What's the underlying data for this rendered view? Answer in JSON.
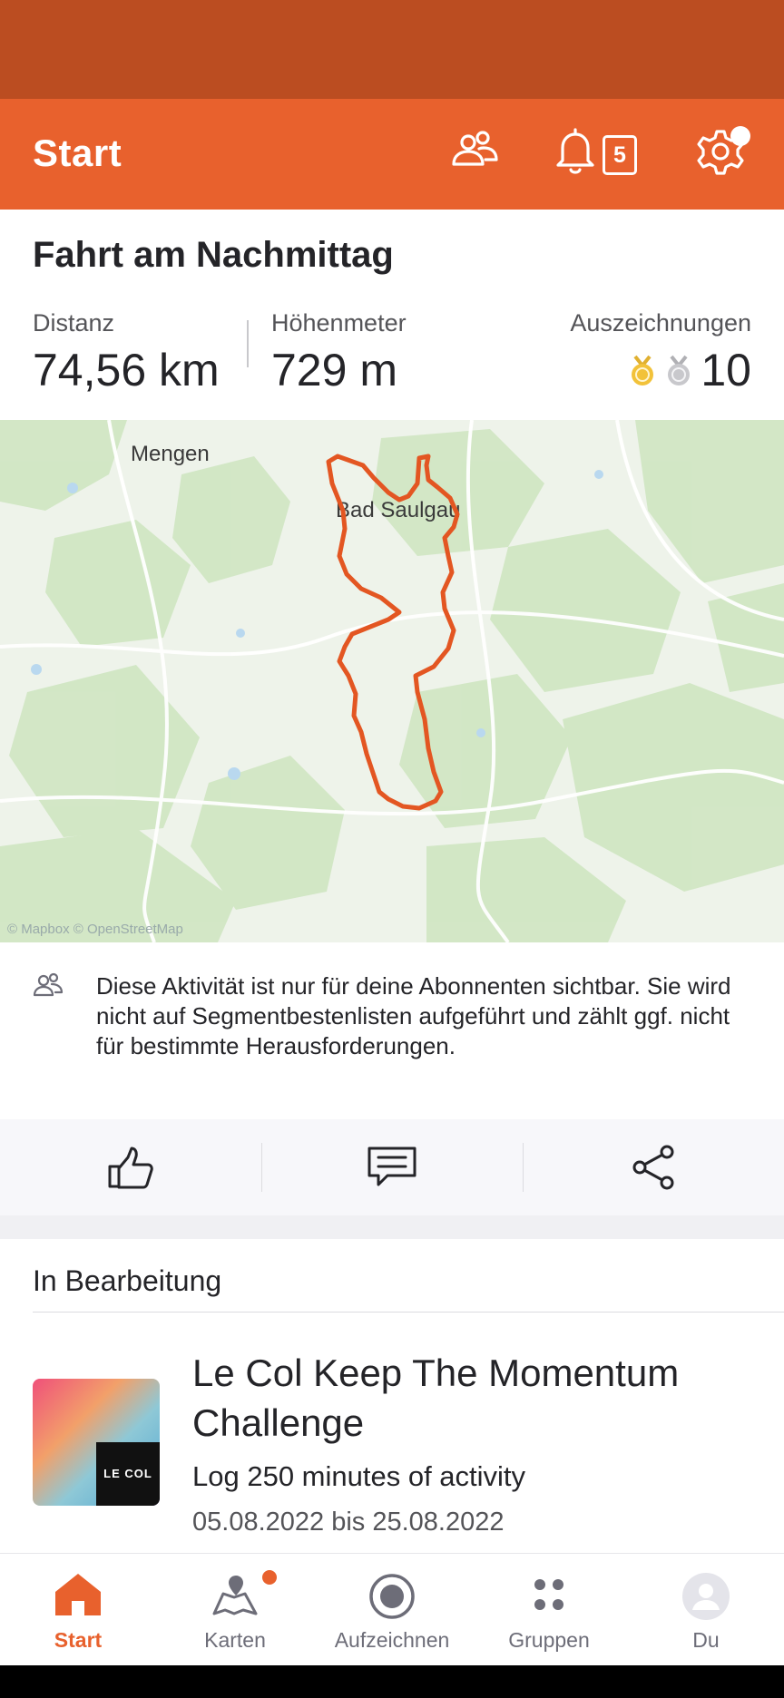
{
  "app": {
    "title": "Start",
    "notification_count": "5",
    "accent_color": "#e8612d"
  },
  "activity": {
    "title": "Fahrt am Nachmittag",
    "stats": [
      {
        "label": "Distanz",
        "value": "74,56 km"
      },
      {
        "label": "Höhenmeter",
        "value": "729 m"
      },
      {
        "label": "Auszeichnungen",
        "value": "10"
      }
    ],
    "map": {
      "places": [
        "Mengen",
        "Bad Saulgau"
      ],
      "attribution": "© Mapbox © OpenStreetMap"
    },
    "privacy_notice": "Diese Aktivität ist nur für deine Abonnenten sichtbar. Sie wird nicht auf Segmentbestenlisten aufgeführt und zählt ggf. nicht für bestimmte Herausforderungen."
  },
  "in_progress": {
    "section_title": "In Bearbeitung",
    "challenge": {
      "name": "Le Col Keep The Momentum Challenge",
      "goal": "Log 250 minutes of activity",
      "dates": "05.08.2022 bis 25.08.2022",
      "logo_text": "LE COL"
    }
  },
  "tabs": [
    {
      "label": "Start",
      "icon": "home-icon",
      "active": true
    },
    {
      "label": "Karten",
      "icon": "maps-icon",
      "active": false
    },
    {
      "label": "Aufzeichnen",
      "icon": "record-icon",
      "active": false
    },
    {
      "label": "Gruppen",
      "icon": "groups-icon",
      "active": false
    },
    {
      "label": "Du",
      "icon": "profile-icon",
      "active": false
    }
  ]
}
